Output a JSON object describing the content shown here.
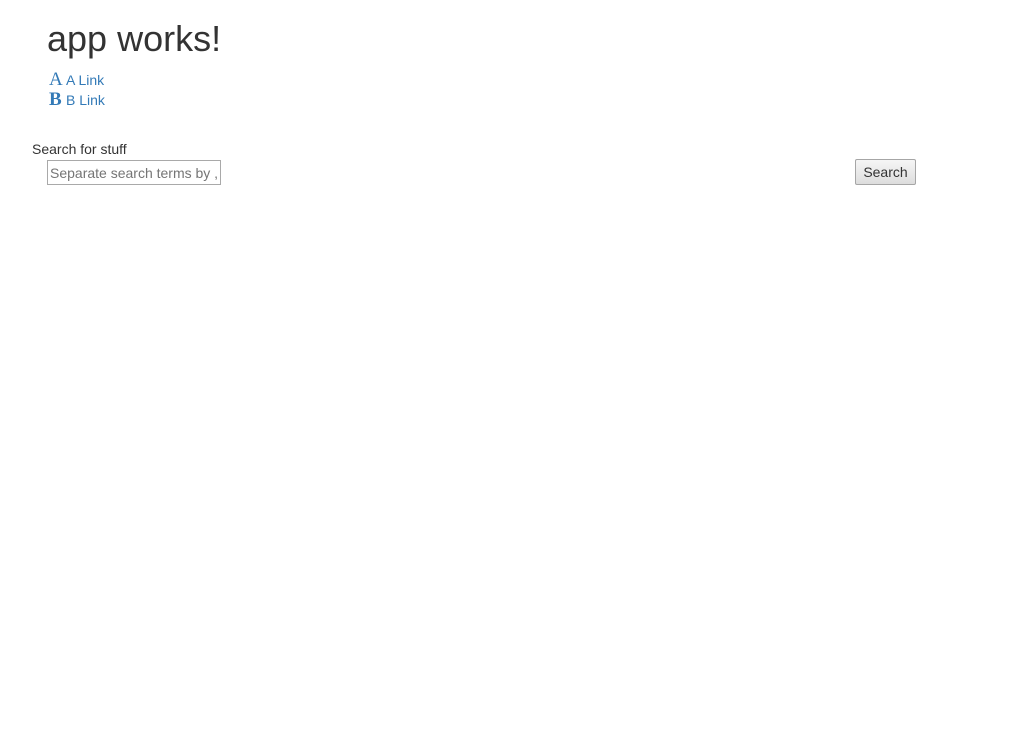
{
  "header": {
    "title": "app works!"
  },
  "links": [
    {
      "icon": "A",
      "icon_name": "letter-a-icon",
      "label": "A Link"
    },
    {
      "icon": "B",
      "icon_name": "letter-b-icon",
      "label": "B Link"
    }
  ],
  "search": {
    "label": "Search for stuff",
    "placeholder": "Separate search terms by ,",
    "value": "",
    "button_label": "Search"
  },
  "colors": {
    "link": "#337ab7",
    "text": "#333333",
    "background": "#ffffff"
  }
}
